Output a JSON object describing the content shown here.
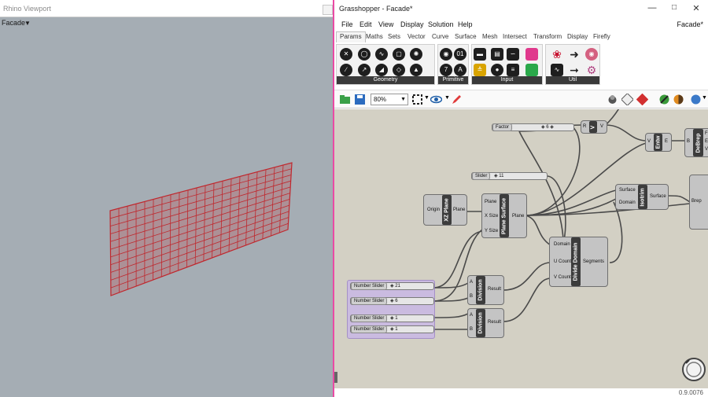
{
  "rhino": {
    "viewport_title": "Rhino Viewport",
    "view_name": "Facade",
    "view_menu_icon": "dropdown-triangle-icon",
    "mesh_color": "#c0272d",
    "mesh_fill": "#b4787e",
    "background": "#a5adb4"
  },
  "grasshopper": {
    "window_title": "Grasshopper - Facade*",
    "document_name": "Facade*",
    "accent": "#ea4aa4",
    "menu": [
      "File",
      "Edit",
      "View",
      "Display",
      "Solution",
      "Help"
    ],
    "tabs": [
      "Params",
      "Maths",
      "Sets",
      "Vector",
      "Curve",
      "Surface",
      "Mesh",
      "Intersect",
      "Transform",
      "Display",
      "Firefly"
    ],
    "active_tab": "Params",
    "ribbon_panels": [
      "Geometry",
      "Primitive",
      "Input",
      "Util"
    ],
    "zoom": "80%",
    "status_value": "0.9.0076",
    "canvas": {
      "sliders": [
        {
          "label": "Factor",
          "value": "6"
        },
        {
          "label": "Slider",
          "value": "11"
        },
        {
          "label": "Number Slider",
          "value": "21"
        },
        {
          "label": "Number Slider",
          "value": "6"
        },
        {
          "label": "Number Slider",
          "value": "1"
        },
        {
          "label": "Number Slider",
          "value": "1"
        }
      ],
      "components": {
        "xz_plane": {
          "name": "XZ Plane",
          "inputs": [
            "Origin"
          ],
          "outputs": [
            "Plane"
          ]
        },
        "plane_surface": {
          "name": "Plane Surface",
          "inputs": [
            "Plane",
            "X Size",
            "Y Size"
          ],
          "outputs": [
            "Plane"
          ]
        },
        "isotrim": {
          "name": "Isotrim",
          "inputs": [
            "Surface",
            "Domain"
          ],
          "outputs": [
            "Surface"
          ]
        },
        "divide_domain": {
          "name": "Divide Domain",
          "inputs": [
            "Domain",
            "U Count",
            "V Count"
          ],
          "outputs": [
            "Segments"
          ]
        },
        "division_1": {
          "name": "Division",
          "inputs": [
            "A",
            "B"
          ],
          "outputs": [
            "Result"
          ]
        },
        "division_2": {
          "name": "Division",
          "inputs": [
            "A",
            "B"
          ],
          "outputs": [
            "Result"
          ]
        },
        "entity": {
          "name": "Entw",
          "inputs": [
            "V"
          ],
          "outputs": [
            "E"
          ]
        },
        "debrep": {
          "name": "DeBrep",
          "inputs": [
            "B"
          ],
          "outputs": [
            "F",
            "E",
            "V"
          ]
        },
        "v_comp": {
          "name": "V",
          "inputs": [
            "R"
          ],
          "outputs": [
            "V"
          ]
        },
        "brep_edge": {
          "name": "Brep",
          "inputs": [
            "Brep"
          ],
          "outputs": []
        }
      }
    }
  }
}
